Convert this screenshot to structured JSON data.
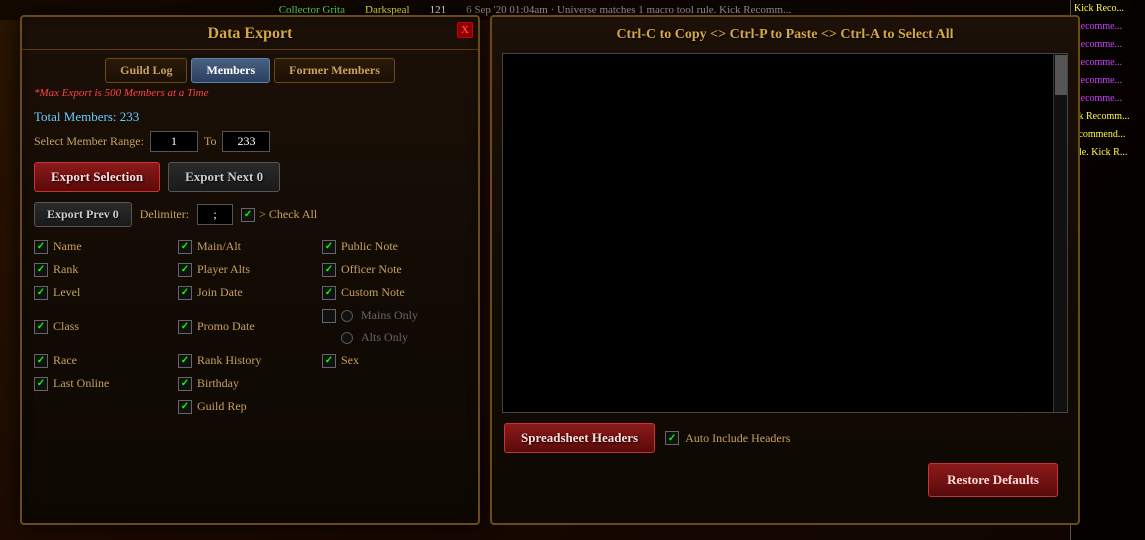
{
  "topbar": {
    "player1": "Collector Grita",
    "player2": "Darkspeal",
    "level": "121",
    "log_text": "6 Sep '20 01:04am · Universe matches 1 macro tool rule. Kick Recomm..."
  },
  "dialog": {
    "title": "Data Export",
    "close_label": "X",
    "tabs": [
      {
        "label": "Guild Log",
        "active": false
      },
      {
        "label": "Members",
        "active": true
      },
      {
        "label": "Former Members",
        "active": false
      }
    ],
    "warning": "*Max Export is 500 Members at a Time",
    "total_members_label": "Total Members:",
    "total_members_value": "233",
    "range_label": "Select Member Range:",
    "range_from": "1",
    "range_to": "233",
    "range_to_label": "To",
    "export_selection_label": "Export Selection",
    "export_next_label": "Export Next 0",
    "export_prev_label": "Export Prev 0",
    "delimiter_label": "Delimiter:",
    "delimiter_value": ";",
    "check_all_label": "> Check All",
    "checkboxes": [
      {
        "col": 0,
        "label": "Name",
        "checked": true
      },
      {
        "col": 0,
        "label": "Rank",
        "checked": true
      },
      {
        "col": 0,
        "label": "Level",
        "checked": true
      },
      {
        "col": 0,
        "label": "Class",
        "checked": true
      },
      {
        "col": 0,
        "label": "Race",
        "checked": true
      },
      {
        "col": 0,
        "label": "Sex",
        "checked": true
      },
      {
        "col": 0,
        "label": "Last Online",
        "checked": true
      },
      {
        "col": 1,
        "label": "Main/Alt",
        "checked": true
      },
      {
        "col": 1,
        "label": "Player Alts",
        "checked": true
      },
      {
        "col": 1,
        "label": "Join Date",
        "checked": true
      },
      {
        "col": 1,
        "label": "Promo Date",
        "checked": true
      },
      {
        "col": 1,
        "label": "Rank History",
        "checked": true
      },
      {
        "col": 1,
        "label": "Birthday",
        "checked": true
      },
      {
        "col": 1,
        "label": "Guild Rep",
        "checked": true
      },
      {
        "col": 2,
        "label": "Public Note",
        "checked": true
      },
      {
        "col": 2,
        "label": "Officer Note",
        "checked": true
      },
      {
        "col": 2,
        "label": "Custom Note",
        "checked": true
      },
      {
        "col": 2,
        "label": "Mains Only",
        "checked": false,
        "radio": true
      },
      {
        "col": 2,
        "label": "Alts Only",
        "checked": false,
        "radio": true
      }
    ],
    "spreadsheet_headers_label": "Spreadsheet Headers",
    "auto_include_label": "Auto Include Headers",
    "restore_defaults_label": "Restore Defaults",
    "copy_hint": "Ctrl-C to Copy <> Ctrl-P to Paste <> Ctrl-A to Select All"
  },
  "chat_lines": [
    {
      "text": "Kick Reco...",
      "color": "yellow"
    },
    {
      "text": "Recomme...",
      "color": "purple"
    },
    {
      "text": "Recomme...",
      "color": "purple"
    },
    {
      "text": "Recomme...",
      "color": "purple"
    },
    {
      "text": "Recomme...",
      "color": "purple"
    },
    {
      "text": "Recomme...",
      "color": "purple"
    },
    {
      "text": "ck Recomm...",
      "color": "yellow"
    },
    {
      "text": "ecommend...",
      "color": "yellow"
    },
    {
      "text": "ule. Kick R...",
      "color": "yellow"
    }
  ]
}
